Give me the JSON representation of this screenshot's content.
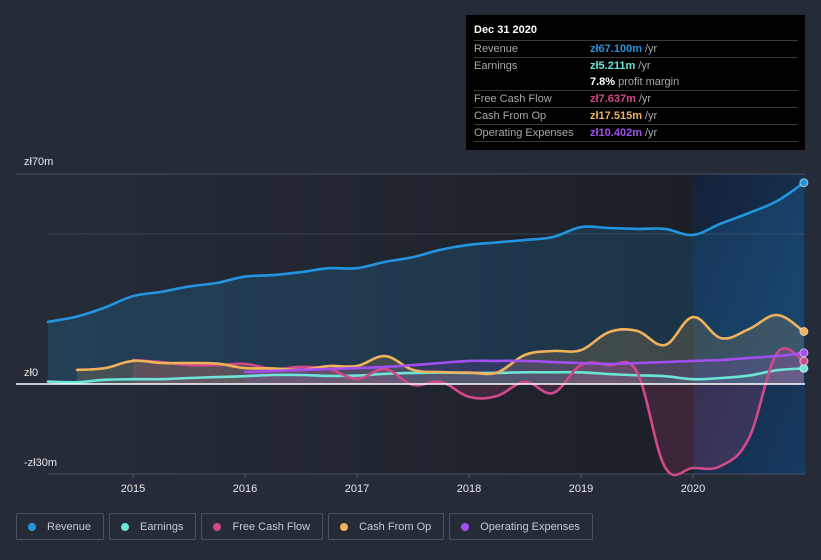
{
  "tooltip": {
    "date": "Dec 31 2020",
    "rows": [
      {
        "label": "Revenue",
        "value": "zł67.100m",
        "unit": "/yr",
        "color": "#2394df"
      },
      {
        "label": "Earnings",
        "value": "zł5.211m",
        "unit": "/yr",
        "color": "#6ce5d6"
      },
      {
        "label": "",
        "value": "7.8%",
        "unit": "profit margin",
        "color": "#ffffff"
      },
      {
        "label": "Free Cash Flow",
        "value": "zł7.637m",
        "unit": "/yr",
        "color": "#d1498a"
      },
      {
        "label": "Cash From Op",
        "value": "zł17.515m",
        "unit": "/yr",
        "color": "#f0b25a"
      },
      {
        "label": "Operating Expenses",
        "value": "zł10.402m",
        "unit": "/yr",
        "color": "#a34ff0"
      }
    ]
  },
  "legend": [
    {
      "label": "Revenue",
      "color": "#2394df"
    },
    {
      "label": "Earnings",
      "color": "#6ce5d6"
    },
    {
      "label": "Free Cash Flow",
      "color": "#d1498a"
    },
    {
      "label": "Cash From Op",
      "color": "#f0b25a"
    },
    {
      "label": "Operating Expenses",
      "color": "#a34ff0"
    }
  ],
  "chart_data": {
    "type": "area",
    "title": "",
    "xlabel": "",
    "ylabel": "",
    "currency": "zł",
    "xlim": [
      2014.24,
      2020.99
    ],
    "ylim": [
      -30,
      70
    ],
    "yticks": [
      {
        "value": 70,
        "label": "zł70m"
      },
      {
        "value": 0,
        "label": "zł0"
      },
      {
        "value": -30,
        "label": "-zł30m"
      }
    ],
    "xticks": [
      2015,
      2016,
      2017,
      2018,
      2019,
      2020
    ],
    "highlight_from": 2020.0,
    "grid": true,
    "series": [
      {
        "name": "Revenue",
        "color": "#2394df",
        "points": [
          [
            2014.24,
            20.7
          ],
          [
            2014.5,
            22.5
          ],
          [
            2014.75,
            25.5
          ],
          [
            2015.0,
            29.3
          ],
          [
            2015.25,
            30.7
          ],
          [
            2015.5,
            32.5
          ],
          [
            2015.75,
            33.7
          ],
          [
            2016.0,
            35.8
          ],
          [
            2016.25,
            36.3
          ],
          [
            2016.5,
            37.3
          ],
          [
            2016.75,
            38.6
          ],
          [
            2017.0,
            38.6
          ],
          [
            2017.25,
            40.7
          ],
          [
            2017.5,
            42.3
          ],
          [
            2017.75,
            44.8
          ],
          [
            2018.0,
            46.4
          ],
          [
            2018.25,
            47.2
          ],
          [
            2018.5,
            48.0
          ],
          [
            2018.75,
            49.0
          ],
          [
            2019.0,
            52.3
          ],
          [
            2019.25,
            52.0
          ],
          [
            2019.5,
            51.7
          ],
          [
            2019.75,
            51.7
          ],
          [
            2020.0,
            49.7
          ],
          [
            2020.25,
            53.5
          ],
          [
            2020.5,
            57.0
          ],
          [
            2020.75,
            61.0
          ],
          [
            2020.99,
            67.1
          ]
        ]
      },
      {
        "name": "Earnings",
        "color": "#6ce5d6",
        "points": [
          [
            2014.24,
            0.8
          ],
          [
            2014.5,
            0.6
          ],
          [
            2014.75,
            1.4
          ],
          [
            2015.0,
            1.6
          ],
          [
            2015.25,
            1.6
          ],
          [
            2015.5,
            2.0
          ],
          [
            2015.75,
            2.3
          ],
          [
            2016.0,
            2.6
          ],
          [
            2016.25,
            3.0
          ],
          [
            2016.5,
            3.0
          ],
          [
            2016.75,
            2.7
          ],
          [
            2017.0,
            2.8
          ],
          [
            2017.25,
            3.4
          ],
          [
            2017.5,
            3.7
          ],
          [
            2017.75,
            3.8
          ],
          [
            2018.0,
            3.7
          ],
          [
            2018.25,
            3.7
          ],
          [
            2018.5,
            3.9
          ],
          [
            2018.75,
            3.9
          ],
          [
            2019.0,
            3.9
          ],
          [
            2019.25,
            3.3
          ],
          [
            2019.5,
            2.9
          ],
          [
            2019.75,
            2.6
          ],
          [
            2020.0,
            1.6
          ],
          [
            2020.25,
            2.0
          ],
          [
            2020.5,
            2.8
          ],
          [
            2020.75,
            4.6
          ],
          [
            2020.99,
            5.2
          ]
        ]
      },
      {
        "name": "Free Cash Flow",
        "color": "#d1498a",
        "points": [
          [
            2015.0,
            8.0
          ],
          [
            2015.25,
            7.3
          ],
          [
            2015.5,
            6.3
          ],
          [
            2015.75,
            6.3
          ],
          [
            2016.0,
            6.7
          ],
          [
            2016.25,
            5.0
          ],
          [
            2016.5,
            5.7
          ],
          [
            2016.75,
            5.0
          ],
          [
            2017.0,
            1.7
          ],
          [
            2017.25,
            5.0
          ],
          [
            2017.5,
            -0.3
          ],
          [
            2017.75,
            0.7
          ],
          [
            2018.0,
            -4.3
          ],
          [
            2018.25,
            -4.0
          ],
          [
            2018.5,
            0.7
          ],
          [
            2018.75,
            -3.0
          ],
          [
            2019.0,
            6.3
          ],
          [
            2019.25,
            6.3
          ],
          [
            2019.5,
            4.0
          ],
          [
            2019.75,
            -27.7
          ],
          [
            2020.0,
            -28.0
          ],
          [
            2020.25,
            -27.3
          ],
          [
            2020.5,
            -18.0
          ],
          [
            2020.75,
            10.3
          ],
          [
            2020.99,
            7.6
          ]
        ]
      },
      {
        "name": "Cash From Op",
        "color": "#f0b25a",
        "points": [
          [
            2014.5,
            4.7
          ],
          [
            2014.75,
            5.3
          ],
          [
            2015.0,
            7.7
          ],
          [
            2015.25,
            7.0
          ],
          [
            2015.5,
            7.0
          ],
          [
            2015.75,
            6.8
          ],
          [
            2016.0,
            5.3
          ],
          [
            2016.25,
            5.2
          ],
          [
            2016.5,
            4.7
          ],
          [
            2016.75,
            6.0
          ],
          [
            2017.0,
            6.0
          ],
          [
            2017.25,
            9.3
          ],
          [
            2017.5,
            4.7
          ],
          [
            2017.75,
            4.0
          ],
          [
            2018.0,
            3.8
          ],
          [
            2018.25,
            3.8
          ],
          [
            2018.5,
            9.7
          ],
          [
            2018.75,
            11.0
          ],
          [
            2019.0,
            11.3
          ],
          [
            2019.25,
            17.3
          ],
          [
            2019.5,
            17.7
          ],
          [
            2019.75,
            13.0
          ],
          [
            2020.0,
            22.3
          ],
          [
            2020.25,
            15.3
          ],
          [
            2020.5,
            18.3
          ],
          [
            2020.75,
            23.0
          ],
          [
            2020.99,
            17.5
          ]
        ]
      },
      {
        "name": "Operating Expenses",
        "color": "#a34ff0",
        "points": [
          [
            2016.0,
            4.0
          ],
          [
            2016.25,
            4.3
          ],
          [
            2016.5,
            4.7
          ],
          [
            2016.75,
            5.0
          ],
          [
            2017.0,
            5.3
          ],
          [
            2017.25,
            5.7
          ],
          [
            2017.5,
            6.3
          ],
          [
            2017.75,
            7.0
          ],
          [
            2018.0,
            7.7
          ],
          [
            2018.25,
            7.7
          ],
          [
            2018.5,
            7.7
          ],
          [
            2018.75,
            7.3
          ],
          [
            2019.0,
            7.0
          ],
          [
            2019.25,
            6.7
          ],
          [
            2019.5,
            7.0
          ],
          [
            2019.75,
            7.3
          ],
          [
            2020.0,
            7.7
          ],
          [
            2020.25,
            8.0
          ],
          [
            2020.5,
            8.7
          ],
          [
            2020.75,
            9.3
          ],
          [
            2020.99,
            10.4
          ]
        ]
      }
    ]
  }
}
